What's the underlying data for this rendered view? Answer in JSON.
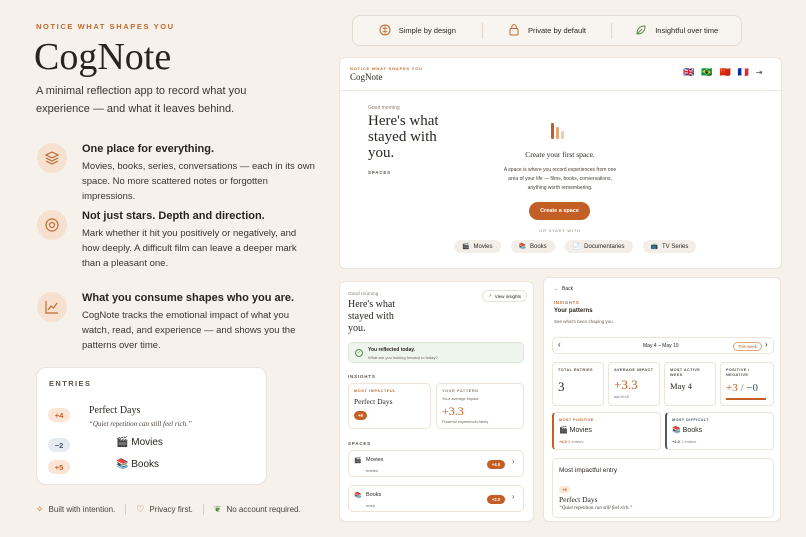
{
  "hero": {
    "eyebrow": "NOTICE WHAT SHAPES YOU",
    "title": "CogNote",
    "description": "A minimal reflection app to record what you experience — and what it leaves behind."
  },
  "features": [
    {
      "title": "One place for everything.",
      "body": "Movies, books, series, conversations — each in its own space. No more scattered notes or forgotten impressions.",
      "icon": "layers-icon"
    },
    {
      "title": "Not just stars. Depth and direction.",
      "body": "Mark whether it hit you positively or negatively, and how deeply. A difficult film can leave a deeper mark than a pleasant one.",
      "icon": "target-icon"
    },
    {
      "title": "What you consume shapes who you are.",
      "body": "CogNote tracks the emotional impact of what you watch, read, and experience — and shows you the patterns over time.",
      "icon": "trend-icon"
    }
  ],
  "entries_card": {
    "heading": "ENTRIES",
    "items": [
      {
        "badge": "+4",
        "title": "Perfect Days",
        "quote": "“Quiet repetition can still feel rich.”"
      },
      {
        "badge": "−2",
        "title": "Movies",
        "emoji": "🎬"
      },
      {
        "badge": "+5",
        "title": "Books",
        "emoji": "📚"
      }
    ]
  },
  "footer": {
    "items": [
      "Built with intention.",
      "Privacy first.",
      "No account required."
    ]
  },
  "benefits": [
    "Simple by design",
    "Private by default",
    "Insightful over time"
  ],
  "app_main": {
    "eyebrow": "NOTICE WHAT SHAPES YOU",
    "brand": "CogNote",
    "flags": [
      "🇬🇧",
      "🇧🇷",
      "🇨🇳",
      "🇫🇷"
    ],
    "greeting": "Good morning",
    "headline_1": "Here's what",
    "headline_2": "stayed with",
    "headline_3": "you.",
    "spaces_label": "SPACES",
    "empty_title": "Create your first space.",
    "empty_body": "A space is where you record experiences from one area of your life — films, books, conversations, anything worth remembering.",
    "create_button": "Create a space",
    "or_label": "OR START WITH",
    "starters": [
      {
        "emoji": "🎬",
        "label": "Movies"
      },
      {
        "emoji": "📚",
        "label": "Books"
      },
      {
        "emoji": "📄",
        "label": "Documentaries"
      },
      {
        "emoji": "📺",
        "label": "TV Series"
      }
    ]
  },
  "app_home": {
    "greeting": "Good morning",
    "headline_1": "Here's what",
    "headline_2": "stayed with",
    "headline_3": "you.",
    "view_insights": "View insights",
    "reflected_title": "You reflected today.",
    "reflected_sub": "What are you looking forward to today?",
    "insights_label": "INSIGHTS",
    "most_impactful_label": "MOST IMPACTFUL",
    "most_impactful_title": "Perfect Days",
    "most_impactful_badge": "+5",
    "pattern_label": "YOUR PATTERN",
    "pattern_sub": "Your average impact",
    "pattern_value": "+3.3",
    "pattern_note": "Powerful experiences lately",
    "spaces_label": "SPACES",
    "spaces": [
      {
        "emoji": "🎬",
        "title": "Movies",
        "sub": "entries",
        "badge": "+4.0"
      },
      {
        "emoji": "📚",
        "title": "Books",
        "sub": "entry",
        "badge": "+2.0"
      }
    ]
  },
  "app_insights": {
    "back": "Back",
    "label": "INSIGHTS",
    "title": "Your patterns",
    "sub": "See what's been shaping you.",
    "range": "May 4 – May 10",
    "range_pill": "This week",
    "stats": [
      {
        "label": "TOTAL ENTRIES",
        "value": "3",
        "note": ""
      },
      {
        "label": "AVERAGE IMPACT",
        "value": "+3.3",
        "note": "out of ±5"
      },
      {
        "label": "MOST ACTIVE WEEK",
        "value": "May 4",
        "note": ""
      },
      {
        "label": "POSITIVE / NEGATIVE",
        "value_pos": "+3",
        "value_sep": "/",
        "value_neg": "−0",
        "note": ""
      }
    ],
    "most_positive": {
      "label": "MOST POSITIVE",
      "emoji": "🎬",
      "title": "Movies",
      "badge": "+4.0",
      "count": "2 entries"
    },
    "most_difficult": {
      "label": "MOST DIFFICULT",
      "emoji": "📚",
      "title": "Books",
      "badge": "+2.0",
      "count": "1 entries"
    },
    "impact_heading": "Most impactful entry",
    "impact_badge": "+5",
    "impact_title": "Perfect Days",
    "impact_quote": "“Quiet repetition can still feel rich.”"
  }
}
